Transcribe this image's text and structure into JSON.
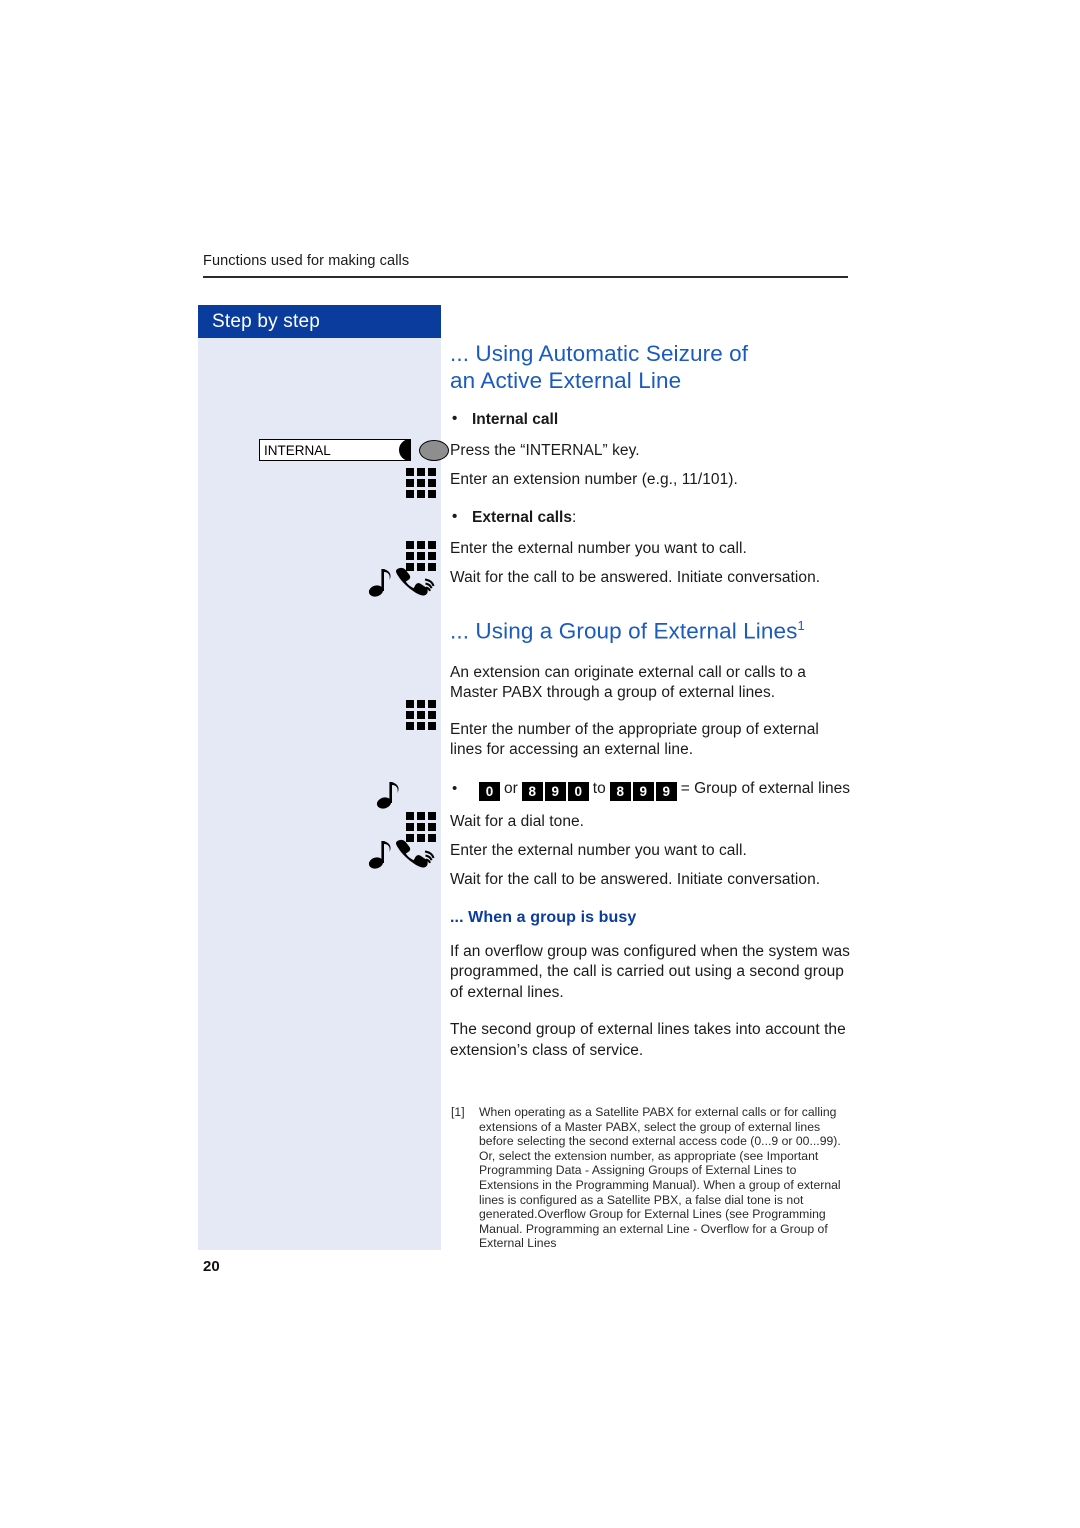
{
  "page": {
    "running_header": "Functions used for making calls",
    "page_number": "20",
    "colors": {
      "brand_blue": "#0a3c9e",
      "heading_blue": "#1b5bbf",
      "sidebar_bg": "#e4e9f5",
      "keycap_bg": "#000000"
    }
  },
  "sidebar": {
    "title": "Step by step",
    "function_key": {
      "label": "INTERNAL",
      "led_state": "grey"
    },
    "icons": [
      {
        "name": "keypad-icon",
        "order": 1
      },
      {
        "name": "keypad-icon",
        "order": 2
      },
      {
        "name": "tone-handset-icon",
        "order": 3
      },
      {
        "name": "keypad-icon",
        "order": 4
      },
      {
        "name": "tone-icon",
        "order": 5
      },
      {
        "name": "keypad-icon",
        "order": 6
      },
      {
        "name": "tone-handset-icon",
        "order": 7
      }
    ]
  },
  "main": {
    "heading_1": "... Using Automatic Seizure of an Active External Line",
    "heading_1_line_1": "... Using Automatic Seizure of",
    "heading_1_line_2": "an Active External Line",
    "internal_call": {
      "bullet_label": "Internal call",
      "steps": [
        "Press the “INTERNAL” key.",
        "Enter an extension number (e.g., 11/101)."
      ]
    },
    "external_calls": {
      "bullet_label": "External calls",
      "bullet_label_suffix": ":",
      "steps": [
        "Enter the external number you want to call.",
        "Wait for the call to be answered. Initiate conversation."
      ]
    },
    "heading_2": "... Using a Group of External Lines",
    "heading_2_footnote_marker": "1",
    "paragraphs": [
      "An extension can originate external call or calls to a Master PABX through a group of external lines.",
      "Enter the number of the appropriate group of external lines for accessing an external line."
    ],
    "key_sequence": {
      "first_key": "0",
      "word_or": "or",
      "range_start": [
        "8",
        "9",
        "0"
      ],
      "word_to": "to",
      "range_end": [
        "8",
        "9",
        "9"
      ],
      "result_text": "= Group of external lines"
    },
    "group_steps": [
      "Wait for a dial tone.",
      "Enter the external number you want to call.",
      "Wait for the call to be answered. Initiate conversation."
    ],
    "heading_3": "... When a group is busy",
    "busy_paragraphs": [
      "If an overflow group was configured when the system was programmed, the call is carried out using a second group of external lines.",
      "The second group of external lines takes into account the extension’s class of service."
    ]
  },
  "footnote": {
    "marker": "[1]",
    "text": "When operating as a Satellite PABX for external calls or for calling extensions of a Master PABX, select the group of external lines before selecting the second external access code (0...9 or 00...99). Or, select the extension number, as appropriate (see Important Programming Data - Assigning Groups of External Lines to Extensions in the Programming Manual). When a group of external lines is configured as a Satellite PBX, a false dial tone is not generated.Overflow Group for External Lines (see Programming Manual. Programming an external Line - Overflow for a Group of External Lines"
  }
}
